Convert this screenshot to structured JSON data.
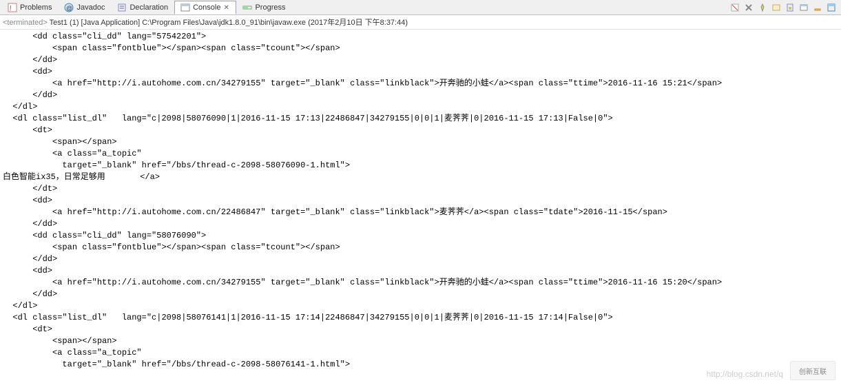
{
  "tabs": [
    {
      "icon": "problems",
      "label": "Problems"
    },
    {
      "icon": "javadoc",
      "label": "Javadoc"
    },
    {
      "icon": "declaration",
      "label": "Declaration"
    },
    {
      "icon": "console",
      "label": "Console",
      "active": true
    },
    {
      "icon": "progress",
      "label": "Progress"
    }
  ],
  "toolbar": {
    "icons": [
      "clear",
      "close-all",
      "pin",
      "display",
      "scroll",
      "new-console",
      "min",
      "max"
    ]
  },
  "header": {
    "terminated": "<terminated>",
    "rest": " Test1 (1) [Java Application] C:\\Program Files\\Java\\jdk1.8.0_91\\bin\\javaw.exe (2017年2月10日 下午8:37:44)"
  },
  "console_output": "      <dd class=\"cli_dd\" lang=\"57542201\">\n          <span class=\"fontblue\"></span><span class=\"tcount\"></span>\n      </dd>\n      <dd>\n          <a href=\"http://i.autohome.com.cn/34279155\" target=\"_blank\" class=\"linkblack\">开奔驰的小蛙</a><span class=\"ttime\">2016-11-16 15:21</span>\n      </dd>\n  </dl>\n  <dl class=\"list_dl\"   lang=\"c|2098|58076090|1|2016-11-15 17:13|22486847|34279155|0|0|1|麦荠荠|0|2016-11-15 17:13|False|0\">\n      <dt>\n          <span></span>\n          <a class=\"a_topic\"\n            target=\"_blank\" href=\"/bbs/thread-c-2098-58076090-1.html\">\n白色智能ix35，日常足够用       </a>\n      </dt>\n      <dd>\n          <a href=\"http://i.autohome.com.cn/22486847\" target=\"_blank\" class=\"linkblack\">麦荠荠</a><span class=\"tdate\">2016-11-15</span>\n      </dd>\n      <dd class=\"cli_dd\" lang=\"58076090\">\n          <span class=\"fontblue\"></span><span class=\"tcount\"></span>\n      </dd>\n      <dd>\n          <a href=\"http://i.autohome.com.cn/34279155\" target=\"_blank\" class=\"linkblack\">开奔驰的小蛙</a><span class=\"ttime\">2016-11-16 15:20</span>\n      </dd>\n  </dl>\n  <dl class=\"list_dl\"   lang=\"c|2098|58076141|1|2016-11-15 17:14|22486847|34279155|0|0|1|麦荠荠|0|2016-11-15 17:14|False|0\">\n      <dt>\n          <span></span>\n          <a class=\"a_topic\"\n            target=\"_blank\" href=\"/bbs/thread-c-2098-58076141-1.html\">",
  "watermark": "http://blog.csdn.net/q",
  "logo": "创新互联"
}
